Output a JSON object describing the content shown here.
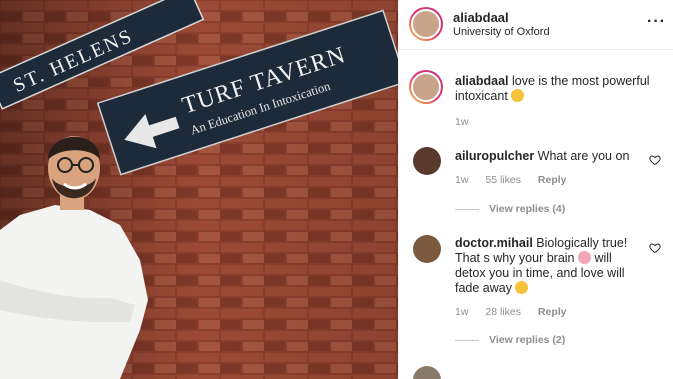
{
  "post": {
    "sign_left": "ST. HELENS",
    "sign_title": "TURF TAVERN",
    "sign_subtitle": "An Education In Intoxication"
  },
  "header": {
    "username": "aliabdaal",
    "location": "University of Oxford",
    "more_icon": "more-horizontal-icon"
  },
  "caption": {
    "username": "aliabdaal",
    "text": "love is the most powerful intoxicant",
    "emoji": "pleading-face",
    "time": "1w"
  },
  "comments": [
    {
      "username": "ailuropulcher",
      "text": "What are you on",
      "time": "1w",
      "likes": "55 likes",
      "reply": "Reply",
      "view_replies": "View replies (4)"
    },
    {
      "username": "doctor.mihail",
      "text_a": "Biologically true! That s why your brain",
      "text_b": "will detox you in time, and love will fade away",
      "emoji_a": "brain",
      "emoji_b": "hands-on-face",
      "time": "1w",
      "likes": "28 likes",
      "reply": "Reply",
      "view_replies": "View replies (2)"
    }
  ],
  "colors": {
    "brick": "#8a4030",
    "sign": "#1d2a3a",
    "muted": "#8e8e8e"
  }
}
